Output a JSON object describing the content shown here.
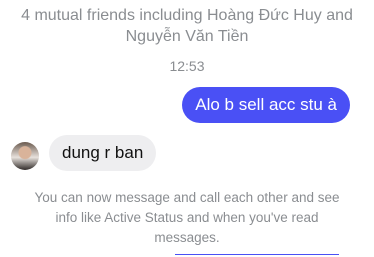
{
  "mutual_friends": {
    "line1": "4 mutual friends including Hoàng Đức Huy and",
    "line2": "Nguyễn Văn Tiền"
  },
  "timestamp": "12:53",
  "messages": [
    {
      "direction": "outgoing",
      "text": "Alo b sell acc stu à"
    },
    {
      "direction": "incoming",
      "text": "dung r ban"
    }
  ],
  "notice": {
    "line1": "You can now message and call each other and see",
    "line2": "info like Active Status and when you've read",
    "line3": "messages."
  },
  "colors": {
    "outgoing_bubble": "#4a50f5",
    "incoming_bubble": "#eeeef0",
    "muted_text": "#8a8d91"
  }
}
